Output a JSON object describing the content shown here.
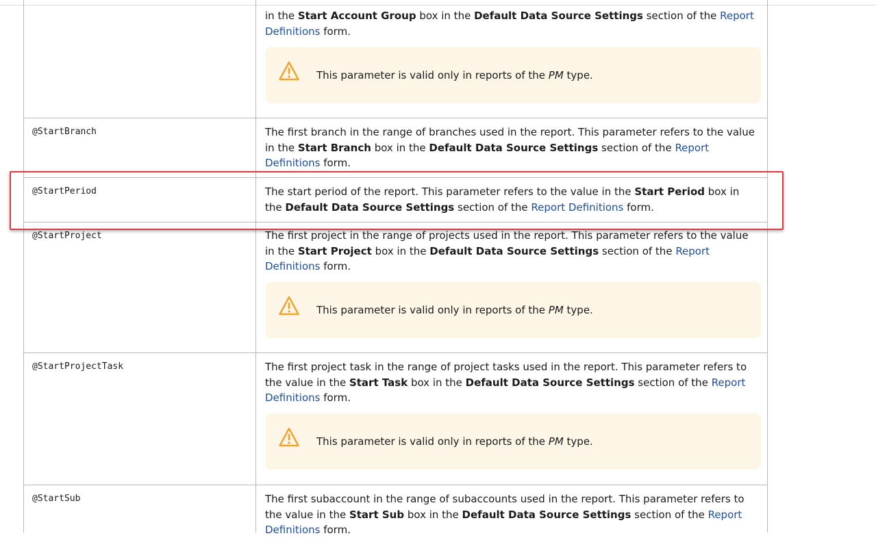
{
  "note": {
    "text_before": "This parameter is valid only in reports of the ",
    "text_type": "PM",
    "text_after": " type."
  },
  "rows": [
    {
      "param": "",
      "lines": [
        {
          "parts": [
            {
              "t": "in the ",
              "b": false
            },
            {
              "t": "Start Account Group",
              "b": true
            },
            {
              "t": " box in the ",
              "b": false
            },
            {
              "t": "Default Data Source Settings",
              "b": true
            },
            {
              "t": " section of the ",
              "b": false
            },
            {
              "t": "Report",
              "link": true
            }
          ]
        },
        {
          "parts": [
            {
              "t": "Definitions",
              "link": true
            },
            {
              "t": " form.",
              "b": false
            }
          ]
        }
      ]
    },
    {
      "param": "@StartBranch",
      "lines": [
        {
          "parts": [
            {
              "t": "The first branch in the range of branches used in the report. This parameter refers to the value",
              "b": false
            }
          ]
        },
        {
          "parts": [
            {
              "t": "in the ",
              "b": false
            },
            {
              "t": "Start Branch",
              "b": true
            },
            {
              "t": " box in the ",
              "b": false
            },
            {
              "t": "Default Data Source Settings",
              "b": true
            },
            {
              "t": " section of the ",
              "b": false
            },
            {
              "t": "Report",
              "link": true
            }
          ]
        },
        {
          "parts": [
            {
              "t": "Definitions",
              "link": true
            },
            {
              "t": " form.",
              "b": false
            }
          ]
        }
      ]
    },
    {
      "param": "@StartPeriod",
      "lines": [
        {
          "parts": [
            {
              "t": "The start period of the report. This parameter refers to the value in the ",
              "b": false
            },
            {
              "t": "Start Period",
              "b": true
            },
            {
              "t": " box in",
              "b": false
            }
          ]
        },
        {
          "parts": [
            {
              "t": "the ",
              "b": false
            },
            {
              "t": "Default Data Source Settings",
              "b": true
            },
            {
              "t": " section of the ",
              "b": false
            },
            {
              "t": "Report Definitions",
              "link": true
            },
            {
              "t": " form.",
              "b": false
            }
          ]
        }
      ]
    },
    {
      "param": "@StartProject",
      "lines": [
        {
          "parts": [
            {
              "t": "The first project in the range of projects used in the report. This parameter refers to the value",
              "b": false
            }
          ]
        },
        {
          "parts": [
            {
              "t": "in the ",
              "b": false
            },
            {
              "t": "Start Project",
              "b": true
            },
            {
              "t": " box in the ",
              "b": false
            },
            {
              "t": "Default Data Source Settings",
              "b": true
            },
            {
              "t": " section of the ",
              "b": false
            },
            {
              "t": "Report",
              "link": true
            }
          ]
        },
        {
          "parts": [
            {
              "t": "Definitions",
              "link": true
            },
            {
              "t": " form.",
              "b": false
            }
          ]
        }
      ]
    },
    {
      "param": "@StartProjectTask",
      "lines": [
        {
          "parts": [
            {
              "t": "The first project task in the range of project tasks used in the report. This parameter refers to",
              "b": false
            }
          ]
        },
        {
          "parts": [
            {
              "t": "the value in the ",
              "b": false
            },
            {
              "t": "Start Task",
              "b": true
            },
            {
              "t": " box in the ",
              "b": false
            },
            {
              "t": "Default Data Source Settings",
              "b": true
            },
            {
              "t": " section of the ",
              "b": false
            },
            {
              "t": "Report",
              "link": true
            }
          ]
        },
        {
          "parts": [
            {
              "t": "Definitions",
              "link": true
            },
            {
              "t": " form.",
              "b": false
            }
          ]
        }
      ]
    },
    {
      "param": "@StartSub",
      "lines": [
        {
          "parts": [
            {
              "t": "The first subaccount in the range of subaccounts used in the report. This parameter refers to",
              "b": false
            }
          ]
        },
        {
          "parts": [
            {
              "t": "the value in the ",
              "b": false
            },
            {
              "t": "Start Sub",
              "b": true
            },
            {
              "t": " box in the ",
              "b": false
            },
            {
              "t": "Default Data Source Settings",
              "b": true
            },
            {
              "t": " section of the ",
              "b": false
            },
            {
              "t": "Report",
              "link": true
            }
          ]
        },
        {
          "parts": [
            {
              "t": "Definitions",
              "link": true
            },
            {
              "t": " form.",
              "b": false
            }
          ]
        }
      ]
    }
  ]
}
